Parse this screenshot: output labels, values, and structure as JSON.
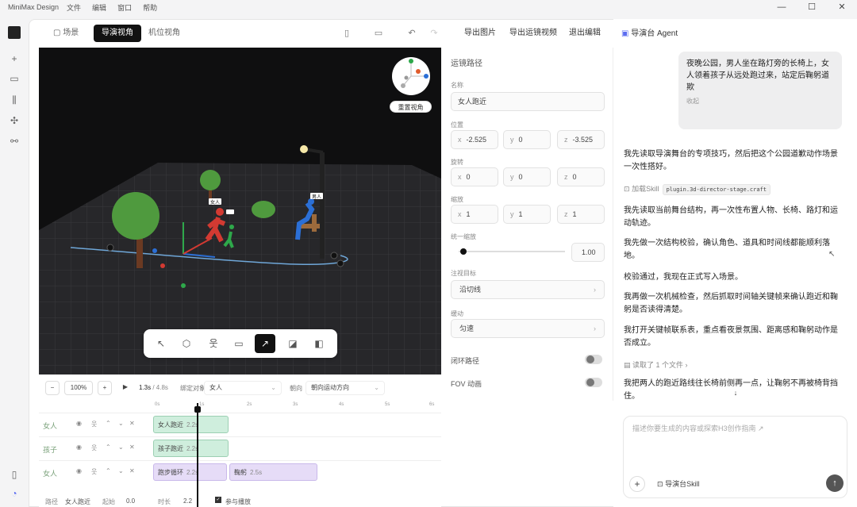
{
  "titlebar": {
    "app": "MiniMax Design",
    "menus": [
      "文件",
      "编辑",
      "窗口",
      "帮助"
    ]
  },
  "toolbar": {
    "tabs": [
      {
        "label": "场景"
      },
      {
        "label": "导演视角"
      },
      {
        "label": "机位视角"
      }
    ],
    "actions": [
      "导出图片",
      "导出运镜视频",
      "退出编辑"
    ]
  },
  "viewport": {
    "reset_view": "重置视角",
    "labels": [
      "女人",
      "孩子",
      "男人"
    ]
  },
  "props": {
    "section": "运镜路径",
    "name_label": "名称",
    "name_value": "女人跑近",
    "pos_label": "位置",
    "pos": {
      "x": "-2.525",
      "y": "0",
      "z": "-3.525"
    },
    "rot_label": "旋转",
    "rot": {
      "x": "0",
      "y": "0",
      "z": "0"
    },
    "scale_label": "缩放",
    "scale": {
      "x": "1",
      "y": "1",
      "z": "1"
    },
    "uniform_label": "统一缩放",
    "uniform_value": "1.00",
    "target_label": "注视目标",
    "target_value": "沿切线",
    "easing_label": "缓动",
    "easing_value": "匀速",
    "closed_label": "闭环路径",
    "fov_label": "FOV 动画",
    "axis": {
      "x": "x",
      "y": "y",
      "z": "z"
    }
  },
  "timeline": {
    "zoom_minus": "−",
    "zoom": "100%",
    "zoom_plus": "+",
    "play": "▶",
    "time": "1.3s",
    "total": "/ 4.8s",
    "bind_label": "绑定对象",
    "bind_value": "女人",
    "facing_label": "朝向",
    "facing_value": "朝向运动方向",
    "ruler": [
      "0s",
      "1s",
      "2s",
      "3s",
      "4s",
      "5s",
      "6s"
    ],
    "tracks": [
      {
        "name": "女人",
        "clips": [
          {
            "label": "女人跑近",
            "dur": "2.2s"
          }
        ]
      },
      {
        "name": "孩子",
        "clips": [
          {
            "label": "孩子跑近",
            "dur": "2.2s"
          }
        ]
      },
      {
        "name": "女人",
        "clips": [
          {
            "label": "跑步循环",
            "dur": "2.2s"
          },
          {
            "label": "鞠躬",
            "dur": "2.5s"
          }
        ]
      }
    ],
    "footer": {
      "path_label": "路径",
      "path_value": "女人跑近",
      "start_label": "起始",
      "start_value": "0.0",
      "dur_label": "时长",
      "dur_value": "2.2",
      "play_label": "参与播放"
    }
  },
  "chat": {
    "header": "导演台 Agent",
    "user_msg": "夜晚公园，男人坐在路灯旁的长椅上，女人领着孩子从远处跑过来，站定后鞠躬道",
    "user_msg_tail": "欺",
    "collapse": "收起",
    "p1": "我先读取导演舞台的专项技巧，然后把这个公园道歉动作场景一次性搭好。",
    "skill_label": "加载Skill",
    "skill_code": "plugin.3d-director-stage.craft",
    "p2": "我先读取当前舞台结构，再一次性布置人物、长椅、路灯和运动轨迹。",
    "p3": "我先做一次结构校验，确认角色、道具和时间线都能顺利落地。",
    "p4": "校验通过，我现在正式写入场景。",
    "p5": "我再做一次机械检查，然后抓取时间轴关键帧来确认跑近和鞠躬是否读得清楚。",
    "p6": "我打开关键帧联系表，重点看夜景氛围、距离感和鞠躬动作是否成立。",
    "read_files": "读取了 1 个文件",
    "p7": "我把两人的跑近路线往长椅前侧再一点，让鞠躬不再被椅背挡住。",
    "placeholder": "描述你要生成的内容或探索H3创作指南 ↗",
    "skill_button": "导演台Skill",
    "add": "+",
    "send": "↑"
  }
}
